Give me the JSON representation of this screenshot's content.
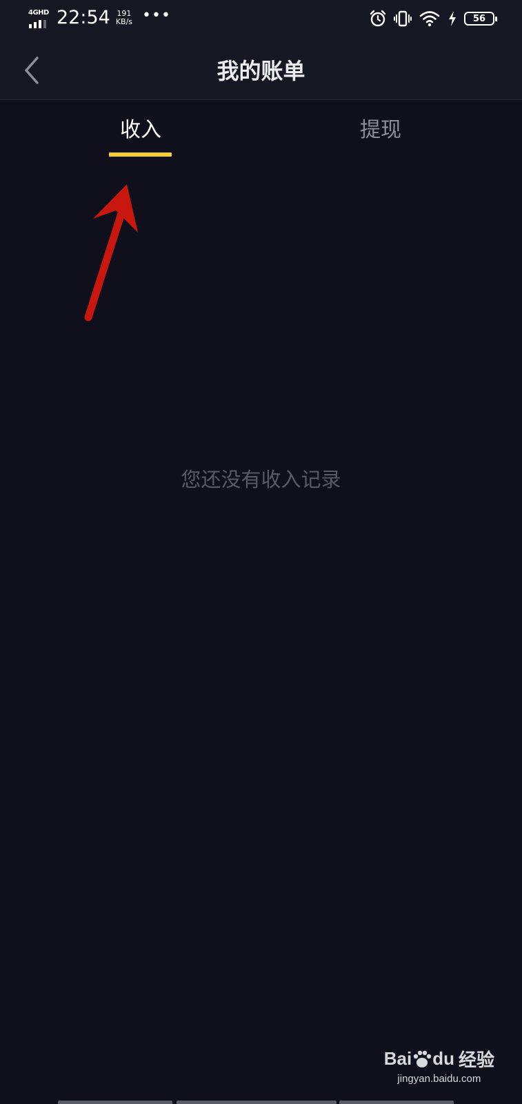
{
  "status_bar": {
    "network": "4GHD",
    "time": "22:54",
    "speed_value": "191",
    "speed_unit": "KB/s",
    "more": "•••",
    "battery": "56"
  },
  "nav": {
    "title": "我的账单",
    "back_icon": "chevron-left-icon"
  },
  "tabs": [
    {
      "label": "收入",
      "active": true
    },
    {
      "label": "提现",
      "active": false
    }
  ],
  "empty_message": "您还没有收入记录",
  "colors": {
    "background": "#0f101b",
    "header": "#151722",
    "accent": "#f5cc32",
    "annotation_arrow": "#c8170f"
  },
  "watermark": {
    "brand": "Bai",
    "brand_suffix": "du",
    "product": "经验",
    "url": "jingyan.baidu.com"
  }
}
